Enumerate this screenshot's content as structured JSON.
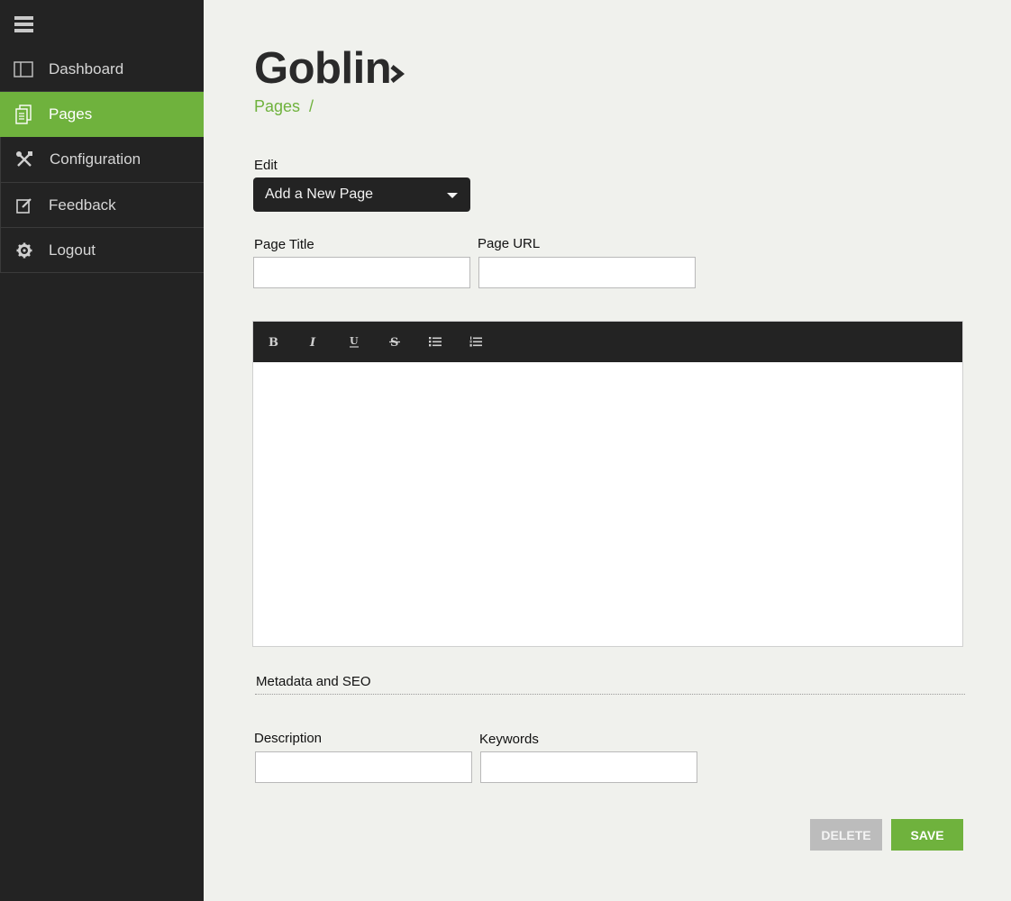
{
  "sidebar": {
    "menu_icon": "hamburger-icon",
    "items": [
      {
        "label": "Dashboard",
        "icon": "dashboard-icon"
      },
      {
        "label": "Pages",
        "icon": "pages-icon",
        "active": true
      },
      {
        "label": "Configuration",
        "icon": "tools-icon"
      },
      {
        "label": "Feedback",
        "icon": "edit-icon"
      },
      {
        "label": "Logout",
        "icon": "gear-icon"
      }
    ]
  },
  "header": {
    "title": "Goblin",
    "title_icon": "chevron-right-icon",
    "breadcrumb": "Pages  /"
  },
  "form": {
    "edit_label": "Edit",
    "edit_select_value": "Add a New Page",
    "page_title_label": "Page Title",
    "page_title_value": "",
    "page_url_label": "Page URL",
    "page_url_value": "",
    "editor_toolbar": [
      "bold-icon",
      "italic-icon",
      "underline-icon",
      "strikethrough-icon",
      "bullet-list-icon",
      "numbered-list-icon"
    ],
    "editor_content": "",
    "metadata_section_title": "Metadata and SEO",
    "description_label": "Description",
    "description_value": "",
    "keywords_label": "Keywords",
    "keywords_value": ""
  },
  "actions": {
    "delete_label": "DELETE",
    "save_label": "SAVE"
  },
  "colors": {
    "accent": "#6fb23d",
    "sidebar_bg": "#232323",
    "page_bg": "#f0f1ed",
    "delete_bg": "#bcbcbc"
  }
}
